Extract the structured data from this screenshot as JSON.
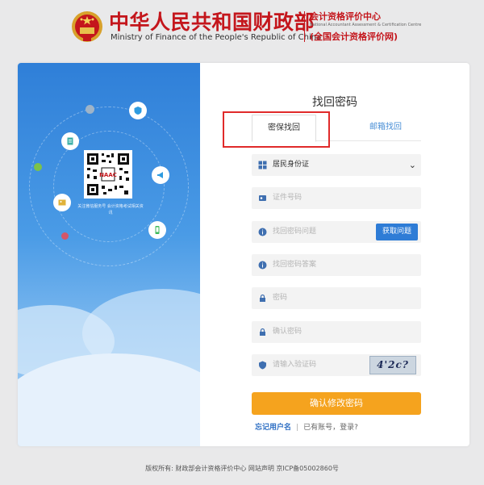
{
  "header": {
    "cn_title": "中华人民共和国财政部",
    "en_title": "Ministry of Finance of the People's Republic of China",
    "sub_cn": "会计资格评价中心",
    "sub_en": "National Accountant Assessment & Certification Centre",
    "sub_cn2": "(全国会计资格评价网)"
  },
  "left_panel": {
    "qr_caption": "关注微信服务号 会计资格考试相关资讯"
  },
  "form": {
    "title": "找回密码",
    "tabs": [
      {
        "label": "密保找回",
        "active": true
      },
      {
        "label": "邮箱找回",
        "active": false
      }
    ],
    "id_type": {
      "value": "居民身份证",
      "icon": "id-card-icon"
    },
    "id_number": {
      "placeholder": "证件号码"
    },
    "question": {
      "placeholder": "找回密码问题",
      "button_label": "获取问题"
    },
    "answer": {
      "placeholder": "找回密码答案"
    },
    "password": {
      "placeholder": "密码"
    },
    "confirm_password": {
      "placeholder": "确认密码"
    },
    "captcha": {
      "placeholder": "请输入验证码",
      "image_text": "4'2c?"
    },
    "submit_label": "确认修改密码",
    "forgot_username": "忘记用户名",
    "register_prompt": "已有账号，登录?"
  },
  "footer": {
    "text": "版权所有: 财政部会计资格评价中心  网站声明  京ICP备05002860号"
  },
  "colors": {
    "brand_red": "#c4161c",
    "primary_blue": "#2e7cd6",
    "accent_orange": "#f5a31e",
    "highlight_red": "#e02a2a"
  }
}
